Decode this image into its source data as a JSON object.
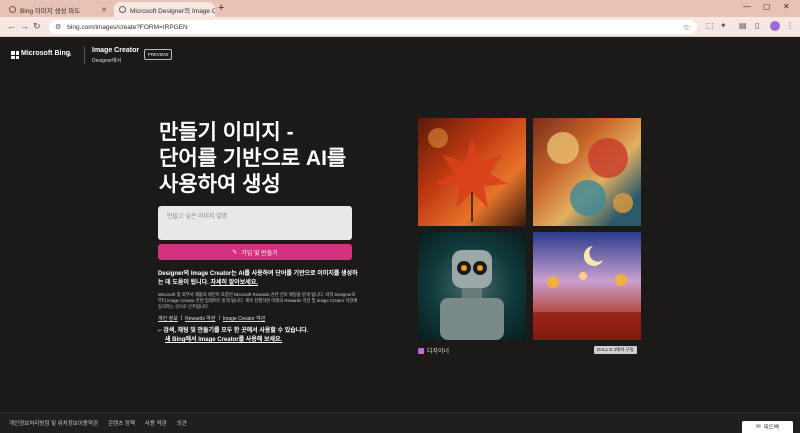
{
  "browser": {
    "tabs": [
      {
        "title": "Bing 이미지 생성 파도"
      },
      {
        "title": "Microsoft Designer의 Image C"
      }
    ],
    "new_tab": "+",
    "url": "bing.com/images/create?FORM=IRPGEN",
    "window": {
      "minimize": "—",
      "maximize": "▢",
      "close": "✕"
    }
  },
  "header": {
    "brand": "Microsoft Bing",
    "product_title": "Image Creator",
    "product_sub": "Designer에서",
    "preview_badge": "PREVIEW"
  },
  "hero": {
    "title_line1": "만들기 이미지 -",
    "title_line2": "단어를 기반으로 AI를",
    "title_line3": "사용하여 생성",
    "prompt_placeholder": "만들고 싶은 이미지 설명",
    "join_button": "가입 및 만들기",
    "description": "Designer의 Image Creator는 AI를 사용하여 단어를 기반으로 이미지를 생성하는 데 도움이 됩니다.",
    "learn_more": "자세히 알아보세요.",
    "fine_print": "Microsoft 및 외부서 제품의 제안이 포함된 Microsoft Rewards 관련 전자 메일을 받게 됩니다. 저희 Designer로부터 Image Creator 관련 업데이트 받게 됩니다. 계속 진행하면 아래의 Rewards 약관 및 Image Creator 약관에 동의하는 것으로 간주됩니다.",
    "links": [
      "개인 정보",
      "Rewards 약관",
      "Image Creator 약관"
    ],
    "link_sep": "|",
    "explore_text": "검색, 채팅 및 만들기를 모두 한 곳에서 사용할 수 있습니다.",
    "explore_link": "새 Bing에서 Image Creator를 사용해 보세요."
  },
  "gallery": {
    "designer_label": "디자이너",
    "dalle_badge": "DALL E 3에서 구동"
  },
  "footer": {
    "links": [
      "개인정보처리방침 및 위치정보이용약관",
      "콘텐츠 정책",
      "사용 약관",
      "의견"
    ],
    "feedback": "피드백"
  }
}
